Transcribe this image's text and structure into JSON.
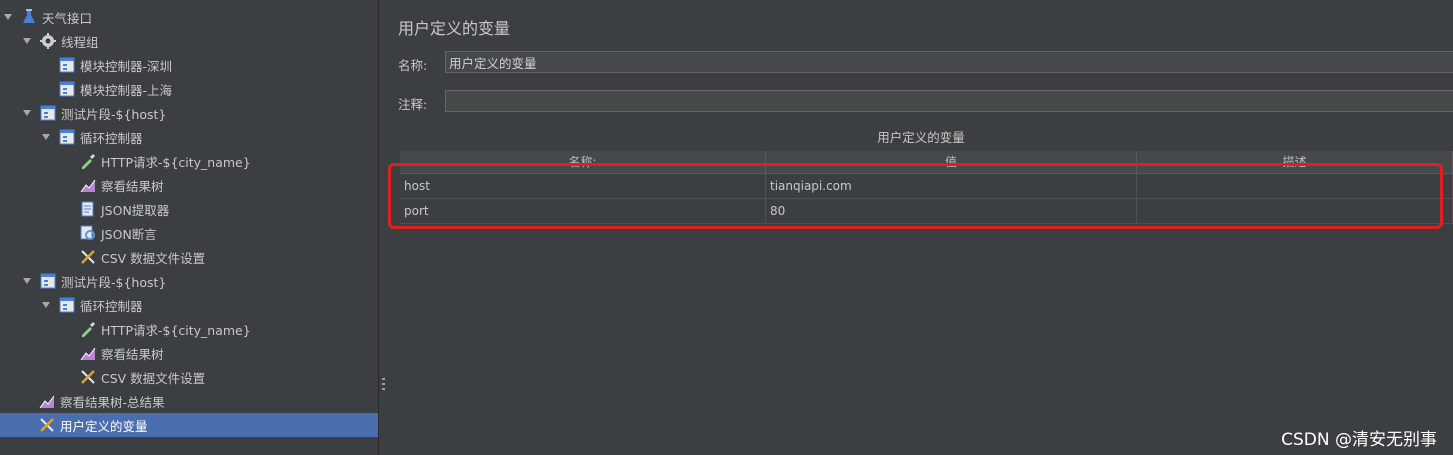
{
  "tree": [
    {
      "label": "天气接口",
      "icon": "test-plan-icon",
      "expanded": true
    },
    {
      "label": "线程组",
      "icon": "thread-group-gear-icon",
      "expanded": true
    },
    {
      "label": "模块控制器-深圳",
      "icon": "module-controller-icon"
    },
    {
      "label": "模块控制器-上海",
      "icon": "module-controller-icon"
    },
    {
      "label": "测试片段-${host}",
      "icon": "test-fragment-icon",
      "expanded": true
    },
    {
      "label": "循环控制器",
      "icon": "loop-controller-icon",
      "expanded": true
    },
    {
      "label": "HTTP请求-${city_name}",
      "icon": "http-sampler-pipette-icon"
    },
    {
      "label": "察看结果树",
      "icon": "view-results-tree-icon"
    },
    {
      "label": "JSON提取器",
      "icon": "json-extractor-icon"
    },
    {
      "label": "JSON断言",
      "icon": "json-assertion-icon"
    },
    {
      "label": "CSV 数据文件设置",
      "icon": "csv-config-tools-icon"
    },
    {
      "label": "测试片段-${host}",
      "icon": "test-fragment-icon",
      "expanded": true
    },
    {
      "label": "循环控制器",
      "icon": "loop-controller-icon",
      "expanded": true
    },
    {
      "label": "HTTP请求-${city_name}",
      "icon": "http-sampler-pipette-icon"
    },
    {
      "label": "察看结果树",
      "icon": "view-results-tree-icon"
    },
    {
      "label": "CSV 数据文件设置",
      "icon": "csv-config-tools-icon"
    },
    {
      "label": "察看结果树-总结果",
      "icon": "view-results-tree-icon"
    },
    {
      "label": "用户定义的变量",
      "icon": "user-variables-tools-icon",
      "selected": true
    }
  ],
  "panel": {
    "title": "用户定义的变量",
    "name_label": "名称:",
    "name_value": "用户定义的变量",
    "comment_label": "注释:",
    "comment_value": "",
    "table_caption": "用户定义的变量",
    "columns": [
      "名称:",
      "值",
      "描述"
    ],
    "rows": [
      [
        "host",
        "tianqiapi.com",
        ""
      ],
      [
        "port",
        "80",
        ""
      ]
    ]
  },
  "watermark": "CSDN @清安无别事",
  "colors": {
    "selection": "#4b6eaf",
    "highlight_box": "#e02020",
    "background": "#3c3f41"
  }
}
